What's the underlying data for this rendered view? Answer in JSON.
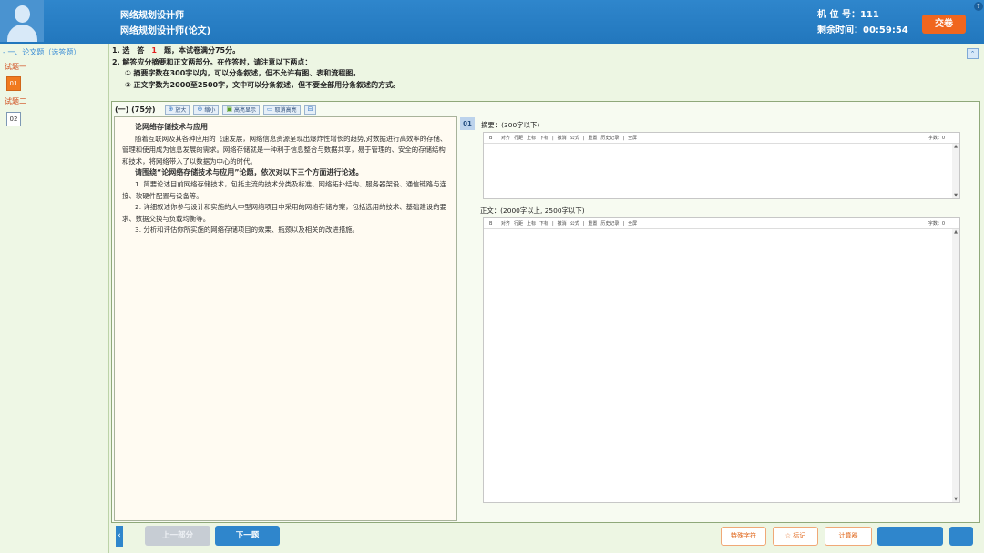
{
  "header": {
    "title_line1": "网络规划设计师",
    "title_line2": "网络规划设计师(论文)",
    "seat_label": "机 位 号：",
    "seat_value": "111",
    "time_label": "剩余时间：",
    "time_value": "00:59:54",
    "submit_label": "交卷",
    "help_label": "?"
  },
  "sidebar": {
    "section_label": "一、论文题（选答题）",
    "groups": [
      {
        "label": "试题一",
        "box": "01"
      },
      {
        "label": "试题二",
        "box": "02"
      }
    ]
  },
  "instructions": {
    "line1_prefix": "1. 选　答　",
    "line1_count": "1",
    "line1_suffix": "　题，本试卷满分75分。",
    "line2": "2. 解答应分摘要和正文两部分。在作答时，请注意以下两点：",
    "line3": "① 摘要字数在300字以内，可以分条叙述，但不允许有图、表和流程图。",
    "line4": "② 正文字数为2000至2500字，文中可以分条叙述，但不要全部用分条叙述的方式。"
  },
  "toolbar": {
    "part_label": "(一) (75分)",
    "zoom_in": "放大",
    "zoom_out": "缩小",
    "highlight": "高亮显示",
    "cancel_highlight": "取消高亮"
  },
  "question": {
    "title": "论网络存储技术与应用",
    "para1": "随着互联网及其各种应用的飞速发展，网络信息资源呈现出爆炸性增长的趋势,对数据进行高效率的存储、管理和使用成为信息发展的需求。网络存储就是一种利于信息整合与数据共享，易于管理的、安全的存储结构和技术，将网络带入了以数据为中心的时代。",
    "para2": "请围绕“论网络存储技术与应用”论题，依次对以下三个方面进行论述。",
    "item1": "1. 简要论述目前网络存储技术，包括主流的技术分类及标准、网络拓扑结构、服务器架设、通信链路与连接、软硬件配置与设备等。",
    "item2": "2. 详细叙述你参与设计和实施的大中型网络项目中采用的网络存储方案，包括选用的技术、基础建设的要求、数据交换与负载均衡等。",
    "item3": "3. 分析和评估你所实施的网络存储项目的效果、瓶颈以及相关的改进措施。"
  },
  "answer": {
    "number": "01",
    "abstract_label": "摘要：(300字以下)",
    "body_label": "正文：(2000字以上, 2500字以下)",
    "word_count": "字数：0",
    "editor_tools": [
      "B",
      "I",
      "对齐",
      "行距",
      "上标",
      "下标",
      "|",
      "撤消",
      "公式",
      "|",
      "重置",
      "历史记录",
      "|",
      "全屏"
    ]
  },
  "bottom": {
    "prev_label": "上一部分",
    "next_label": "下一题",
    "special_char_label": "特殊字符",
    "mark_label": "标记",
    "calc_label": "计算器",
    "collapse_label": "‹"
  }
}
